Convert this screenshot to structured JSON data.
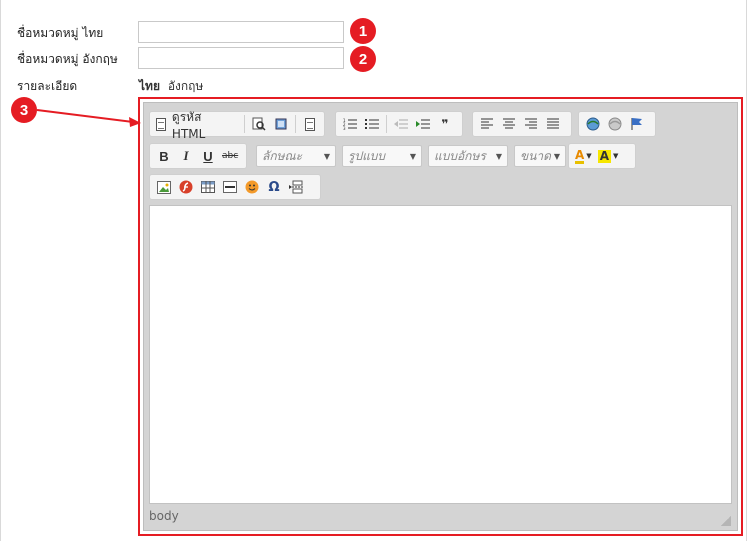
{
  "form": {
    "thai_name_label": "ชื่อหมวดหมู่ ไทย",
    "thai_name_value": "",
    "english_name_label": "ชื่อหมวดหมู่ อังกฤษ",
    "english_name_value": "",
    "detail_label": "รายละเอียด",
    "lang_active": "ไทย",
    "lang_inactive": "อังกฤษ"
  },
  "badges": [
    "1",
    "2",
    "3"
  ],
  "editor": {
    "source_label": "ดูรหัส HTML",
    "style_combo": "ลักษณะ",
    "format_combo": "รูปแบบ",
    "font_combo": "แบบอักษร",
    "size_combo": "ขนาด",
    "status_path": "body",
    "bold": "B",
    "italic": "I",
    "underline": "U",
    "strike": "abc",
    "text_color_glyph": "A",
    "bg_color_glyph": "A",
    "omega": "Ω",
    "quote": "❞"
  },
  "colors": {
    "badge": "#e51c23",
    "highlight": "#e51c23",
    "toolbar_bg": "#d4d4d4"
  }
}
